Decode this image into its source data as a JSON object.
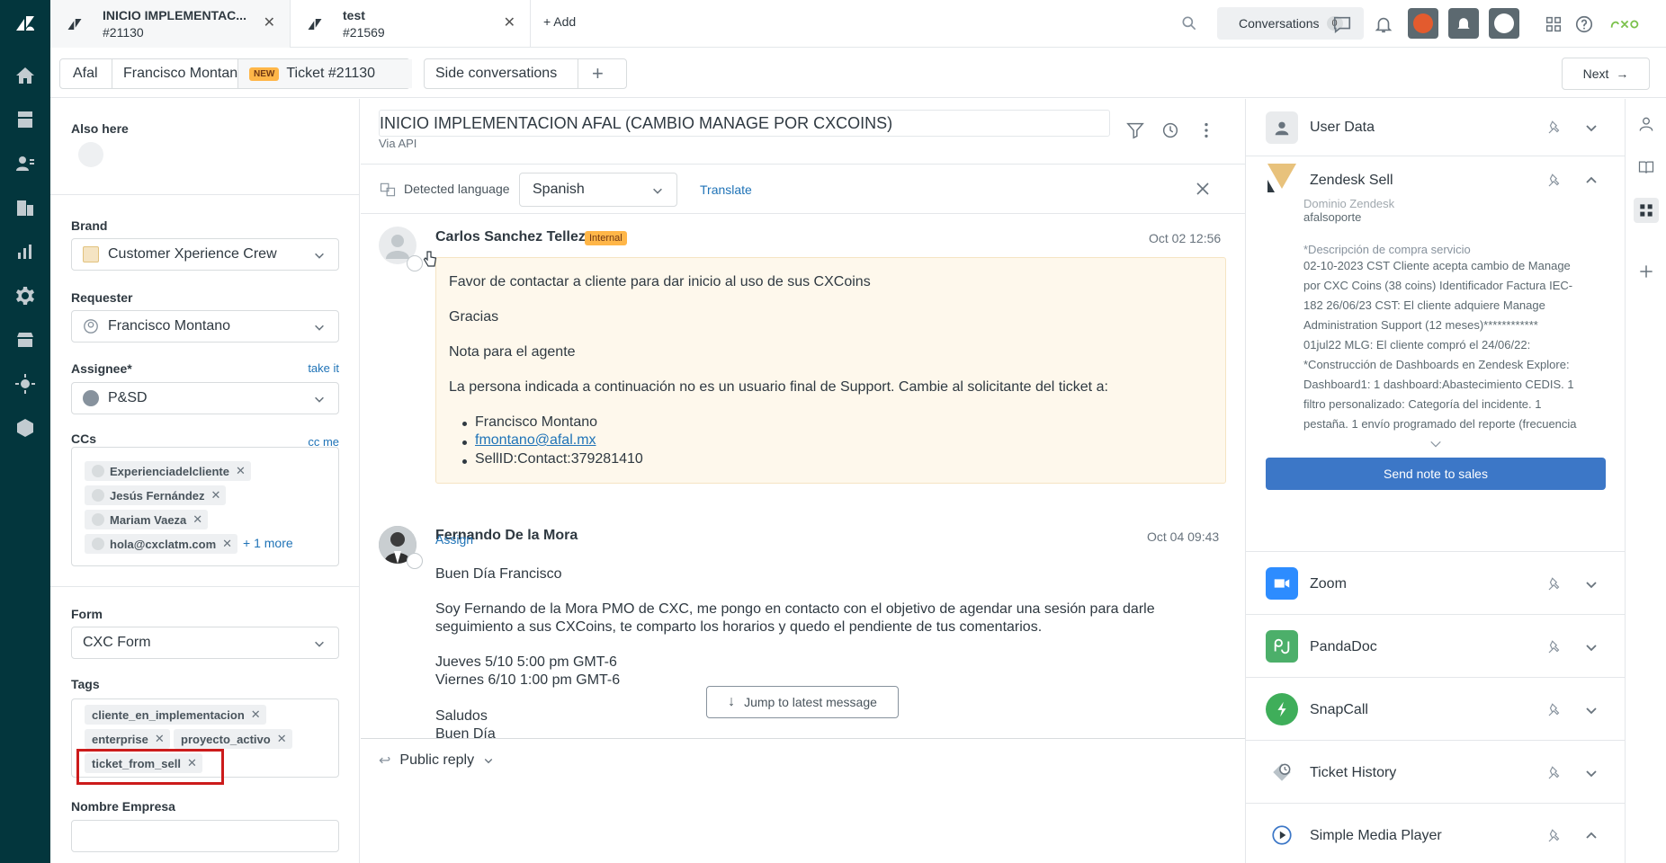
{
  "tabs": [
    {
      "title": "INICIO IMPLEMENTAC...",
      "subtitle": "#21130"
    },
    {
      "title": "test",
      "subtitle": "#21569"
    }
  ],
  "add_tab_label": "Add",
  "conversations": {
    "label": "Conversations",
    "count": "0"
  },
  "crumbs": {
    "org": "Afal",
    "requester": "Francisco Montano",
    "new_badge": "NEW",
    "ticket": "Ticket #21130"
  },
  "side_conversations_label": "Side conversations",
  "next_label": "Next",
  "props": {
    "also_here_label": "Also here",
    "brand_label": "Brand",
    "brand_value": "Customer Xperience Crew",
    "requester_label": "Requester",
    "requester_value": "Francisco Montano",
    "assignee_label": "Assignee*",
    "take_it": "take it",
    "assignee_value": "P&SD",
    "ccs_label": "CCs",
    "cc_me": "cc me",
    "ccs": [
      "Experienciadelcliente",
      "Jesús Fernández",
      "Mariam Vaeza",
      "hola@cxclatm.com"
    ],
    "ccs_more": "+ 1 more",
    "form_label": "Form",
    "form_value": "CXC Form",
    "tags_label": "Tags",
    "tags": [
      "cliente_en_implementacion",
      "enterprise",
      "proyecto_activo",
      "ticket_from_sell"
    ],
    "nombre_empresa_label": "Nombre Empresa"
  },
  "ticket": {
    "subject": "INICIO IMPLEMENTACION AFAL (CAMBIO MANAGE POR CXCOINS)",
    "via": "Via API",
    "detected_language_label": "Detected language",
    "language": "Spanish",
    "translate": "Translate"
  },
  "messages": [
    {
      "author": "Carlos Sanchez Tellez",
      "badge": "Internal",
      "time": "Oct 02 12:56",
      "lines": [
        "Favor de contactar a cliente para dar inicio al uso de sus CXCoins",
        "Gracias",
        "Nota para el agente",
        "La persona indicada a continuación no es un usuario final de Support. Cambie al solicitante del ticket a:"
      ],
      "bullets": [
        "Francisco Montano",
        "fmontano@afal.mx",
        "SellID:Contact:379281410"
      ]
    },
    {
      "author": "Fernando De la Mora",
      "assign": "Assign",
      "time": "Oct 04 09:43",
      "lines": [
        "Buen Día Francisco",
        "Soy Fernando de la Mora PMO de CXC, me pongo en contacto con el objetivo de agendar una sesión para darle",
        "seguimiento a sus CXCoins, te comparto los horarios y quedo el pendiente de tus comentarios.",
        "Jueves 5/10 5:00 pm GMT-6",
        "Viernes 6/10 1:00 pm GMT-6",
        "Saludos",
        "Buen Día"
      ]
    }
  ],
  "jump_label": "Jump to latest message",
  "reply_label": "Public reply",
  "apps": {
    "user_data": "User Data",
    "zendesk_sell": "Zendesk Sell",
    "sell_lines": [
      "Dominio Zendesk",
      "afalsoporte",
      "*Descripción de compra servicio",
      "02-10-2023 CST Cliente acepta cambio de Manage",
      "por CXC Coins (38 coins) Identificador Factura IEC-",
      "182 26/06/23 CST: El cliente adquiere Manage",
      "Administration Support (12 meses)************",
      "01jul22 MLG: El cliente compró el 24/06/22:",
      "*Construcción de Dashboards en Zendesk Explore:",
      "Dashboard1: 1 dashboard:Abastecimiento CEDIS. 1",
      "filtro personalizado: Categoría del incidente. 1",
      "pestaña. 1 envío programado del reporte (frecuencia"
    ],
    "send_note": "Send note to sales",
    "zoom": "Zoom",
    "pandadoc": "PandaDoc",
    "snapcall": "SnapCall",
    "ticket_history": "Ticket History",
    "simple_media_player": "Simple Media Player"
  },
  "colors": {
    "rail": "#03363d",
    "internal_badge": "#ffb648",
    "note_bg": "#fef8ec",
    "link": "#1f73b7",
    "send_button": "#3c77c7",
    "highlight": "#cc1b1b"
  }
}
